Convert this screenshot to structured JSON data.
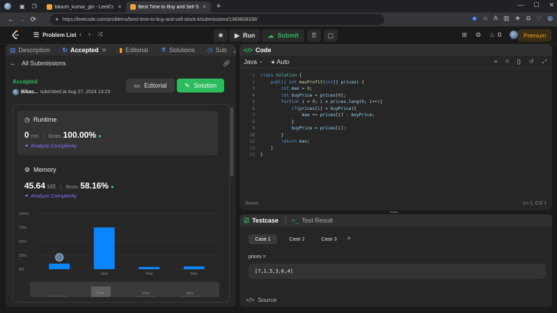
{
  "browser": {
    "tabs": [
      {
        "label": "bikash_kumar_giri - LeetCode Pro"
      },
      {
        "label": "Best Time to Buy and Sell Stock II"
      }
    ],
    "new_tab": "+",
    "url": "https://leetcode.com/problems/best-time-to-buy-and-sell-stock-ii/submissions/1369808338/"
  },
  "nav": {
    "problem_list": "Problem List",
    "run": "Run",
    "submit": "Submit",
    "streak": "0",
    "premium": "Premium"
  },
  "left_tabs": [
    {
      "label": "Description"
    },
    {
      "label": "Accepted"
    },
    {
      "label": "Editorial"
    },
    {
      "label": "Solutions"
    },
    {
      "label": "Sub"
    }
  ],
  "submission": {
    "back": "All Submissions",
    "status": "Accepted",
    "user": "Bikas...",
    "submitted_at": "submitted at Aug 27, 2024 13:23",
    "editorial_btn": "Editorial",
    "solution_btn": "Solution",
    "runtime": {
      "title": "Runtime",
      "value": "0",
      "unit": "ms",
      "beats_label": "Beats",
      "beats": "100.00%",
      "analyze": "Analyze Complexity"
    },
    "memory": {
      "title": "Memory",
      "value": "45.64",
      "unit": "MB",
      "beats_label": "Beats",
      "beats": "58.16%",
      "analyze": "Analyze Complexity"
    }
  },
  "chart_data": {
    "type": "bar",
    "y_ticks": [
      "100%",
      "75%",
      "50%",
      "25%",
      "0%"
    ],
    "ylim": [
      0,
      100
    ],
    "categories": [
      "",
      "1ms",
      "2ms",
      "3ms"
    ],
    "values": [
      10,
      75,
      4,
      5
    ],
    "mini_labels": [
      "1ms",
      "2ms",
      "3ms"
    ]
  },
  "code_panel": {
    "title": "Code",
    "language": "Java",
    "mode": "Auto",
    "status": "Saved",
    "cursor": "Ln 1, Col 1",
    "lines": [
      "class Solution {",
      "    public int maxProfit(int[] prices) {",
      "        int max = 0;",
      "        int buyPrice = prices[0];",
      "        for(int i = 0; i < prices.length; i++){",
      "            if(prices[i] > buyPrice){",
      "                max += prices[i] - buyPrice;",
      "            }",
      "            buyPrice = prices[i];",
      "        }",
      "        return max;",
      "    }",
      "}"
    ]
  },
  "testcase_panel": {
    "tab_testcase": "Testcase",
    "tab_result": "Test Result",
    "cases": [
      "Case 1",
      "Case 2",
      "Case 3"
    ],
    "add": "+",
    "param_label": "prices =",
    "param_value": "[7,1,5,3,6,4]",
    "source": "Source"
  }
}
